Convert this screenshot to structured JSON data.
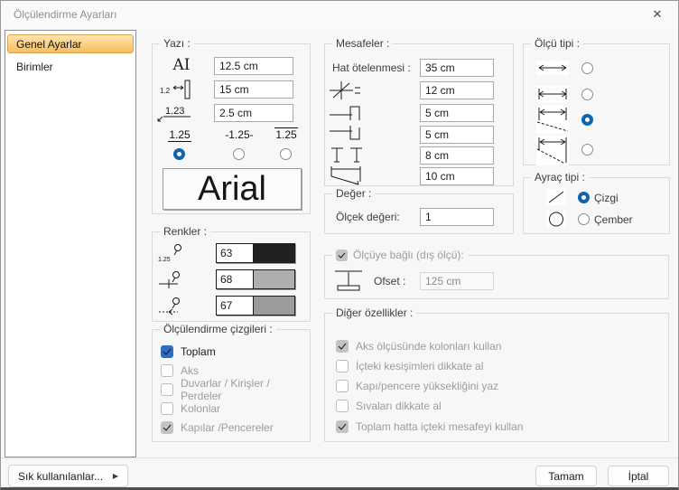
{
  "window": {
    "title": "Ölçülendirme Ayarları",
    "close_glyph": "✕"
  },
  "colors": {
    "checkbox_blue": "#2e6fc1",
    "radio_blue": "#1063ad",
    "sidebar_selected_orange": "#f8bd5e"
  },
  "sidebar": {
    "items": [
      {
        "label": "Genel Ayarlar",
        "selected": true
      },
      {
        "label": "Birimler",
        "selected": false
      }
    ]
  },
  "yazi": {
    "legend": "Yazı :",
    "height_icon_glyph": "AI",
    "fields": [
      {
        "value": "12.5 cm"
      },
      {
        "value": "15 cm"
      },
      {
        "value": "2.5 cm"
      }
    ],
    "position_labels": [
      "1.25",
      "-1.25-",
      "1.25"
    ],
    "position_selected_index": 0,
    "font_name": "Arial"
  },
  "renkler": {
    "legend": "Renkler :",
    "rows": [
      {
        "number": "63",
        "color": "#212121"
      },
      {
        "number": "68",
        "color": "#aeaeae"
      },
      {
        "number": "67",
        "color": "#9b9b9b"
      }
    ]
  },
  "cizgiler": {
    "legend": "Ölçülendirme çizgileri :",
    "items": [
      {
        "label": "Toplam",
        "checked": true,
        "disabled": false
      },
      {
        "label": "Aks",
        "checked": false,
        "disabled": true
      },
      {
        "label": "Duvarlar / Kirişler / Perdeler",
        "checked": false,
        "disabled": true
      },
      {
        "label": "Kolonlar",
        "checked": false,
        "disabled": true
      },
      {
        "label": "Kapılar /Pencereler",
        "checked": true,
        "disabled": true
      }
    ]
  },
  "mesafeler": {
    "legend": "Mesafeler :",
    "first_row_label": "Hat ötelenmesi :",
    "values": [
      "35 cm",
      "12 cm",
      "5 cm",
      "5 cm",
      "8 cm",
      "10 cm"
    ]
  },
  "deger": {
    "legend": "Değer :",
    "label": "Ölçek değeri:",
    "value": "1"
  },
  "olcuye_bagli": {
    "legend": "Ölçüye bağlı (dış ölçü):",
    "checked": true,
    "disabled": true,
    "offset_label": "Ofset :",
    "offset_value": "125 cm"
  },
  "diger": {
    "legend": "Diğer özellikler :",
    "items": [
      {
        "label": "Aks ölçüsünde kolonları kullan",
        "checked": true,
        "disabled": true
      },
      {
        "label": "İçteki kesişimleri dikkate al",
        "checked": false,
        "disabled": true
      },
      {
        "label": "Kapı/pencere yüksekliğini yaz",
        "checked": false,
        "disabled": true
      },
      {
        "label": "Sıvaları dikkate al",
        "checked": false,
        "disabled": true
      },
      {
        "label": "Toplam hatta içteki mesafeyi kullan",
        "checked": true,
        "disabled": true
      }
    ]
  },
  "olcu_tipi": {
    "legend": "Ölçü tipi :",
    "selected_index": 2
  },
  "ayrac_tipi": {
    "legend": "Ayraç tipi :",
    "options": [
      {
        "label": "Çizgi",
        "selected": true
      },
      {
        "label": "Çember",
        "selected": false
      }
    ]
  },
  "footer": {
    "favorites": "Sık kullanılanlar...",
    "favorites_arrow": "▶",
    "ok": "Tamam",
    "cancel": "İptal"
  }
}
